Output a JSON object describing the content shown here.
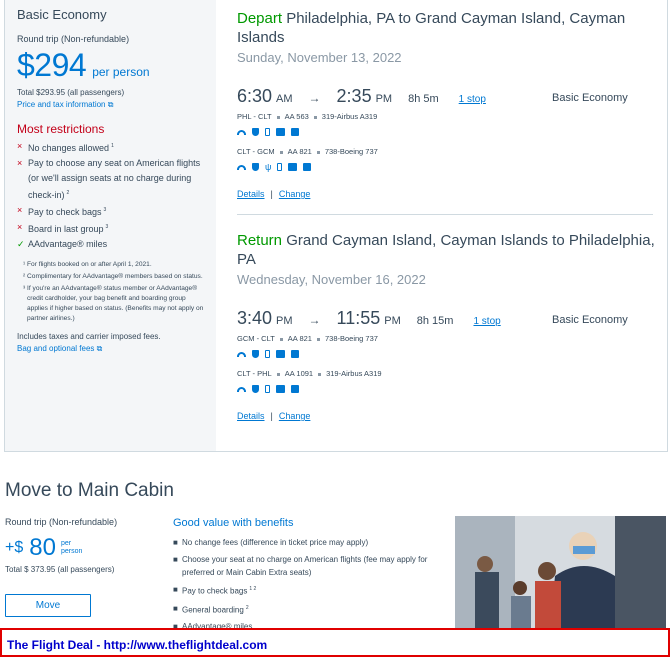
{
  "fare": {
    "name": "Basic Economy",
    "trip_type": "Round trip (Non-refundable)",
    "price": "$294",
    "per_person": "per person",
    "total": "Total $293.95 (all passengers)",
    "price_info_link": "Price and tax information",
    "restrictions_heading": "Most restrictions",
    "restrictions": [
      {
        "mark": "×",
        "text": "No changes allowed",
        "sup": "1"
      },
      {
        "mark": "×",
        "text": "Pay to choose any seat on American flights (or we'll assign seats at no charge during check-in)",
        "sup": "2"
      },
      {
        "mark": "×",
        "text": "Pay to check bags",
        "sup": "3"
      },
      {
        "mark": "×",
        "text": "Board in last group",
        "sup": "3"
      },
      {
        "mark": "✓",
        "text": "AAdvantage® miles",
        "sup": ""
      }
    ],
    "footnotes": [
      "¹ For flights booked on or after April 1, 2021.",
      "² Complimentary for AAdvantage® members based on status.",
      "³ If you're an AAdvantage® status member or AAdvantage® credit cardholder, your bag benefit and boarding group applies if higher based on status. (Benefits may not apply on partner airlines.)"
    ],
    "taxes_note": "Includes taxes and carrier imposed fees.",
    "bag_fees_link": "Bag and optional fees"
  },
  "depart": {
    "label": "Depart",
    "route": "Philadelphia, PA to Grand Cayman Island, Cayman Islands",
    "date": "Sunday, November 13, 2022",
    "dep_time": "6:30",
    "dep_ampm": "AM",
    "arr_time": "2:35",
    "arr_ampm": "PM",
    "duration": "8h 5m",
    "stops": "1 stop",
    "cabin": "Basic Economy",
    "seg1": {
      "route": "PHL - CLT",
      "flight": "AA 563",
      "aircraft": "319-Airbus A319"
    },
    "seg2": {
      "route": "CLT - GCM",
      "flight": "AA 821",
      "aircraft": "738-Boeing 737"
    },
    "details": "Details",
    "change": "Change"
  },
  "return": {
    "label": "Return",
    "route": "Grand Cayman Island, Cayman Islands to Philadelphia, PA",
    "date": "Wednesday, November 16, 2022",
    "dep_time": "3:40",
    "dep_ampm": "PM",
    "arr_time": "11:55",
    "arr_ampm": "PM",
    "duration": "8h 15m",
    "stops": "1 stop",
    "cabin": "Basic Economy",
    "seg1": {
      "route": "GCM - CLT",
      "flight": "AA 821",
      "aircraft": "738-Boeing 737"
    },
    "seg2": {
      "route": "CLT - PHL",
      "flight": "AA 1091",
      "aircraft": "319-Airbus A319"
    },
    "details": "Details",
    "change": "Change"
  },
  "main_cabin": {
    "title": "Move to Main Cabin",
    "trip_type": "Round trip (Non-refundable)",
    "plus": "+$",
    "amount": "80",
    "per": "per",
    "person": "person",
    "total": "Total $ 373.95 (all passengers)",
    "button": "Move",
    "benefits_heading": "Good value with benefits",
    "benefits": [
      {
        "text": "No change fees (difference in ticket price may apply)",
        "sup": ""
      },
      {
        "text": "Choose your seat at no charge on American flights (fee may apply for preferred or Main Cabin Extra seats)",
        "sup": ""
      },
      {
        "text": "Pay to check bags",
        "sup": "1 2"
      },
      {
        "text": "General boarding",
        "sup": "2"
      },
      {
        "text": "AAdvantage® miles",
        "sup": ""
      }
    ]
  },
  "banner": {
    "text": "The Flight Deal - http://www.theflightdeal.com"
  },
  "colors": {
    "accent_blue": "#0078d2",
    "green": "#009900",
    "restriction_red": "#c30019",
    "banner_border": "#e00000"
  }
}
